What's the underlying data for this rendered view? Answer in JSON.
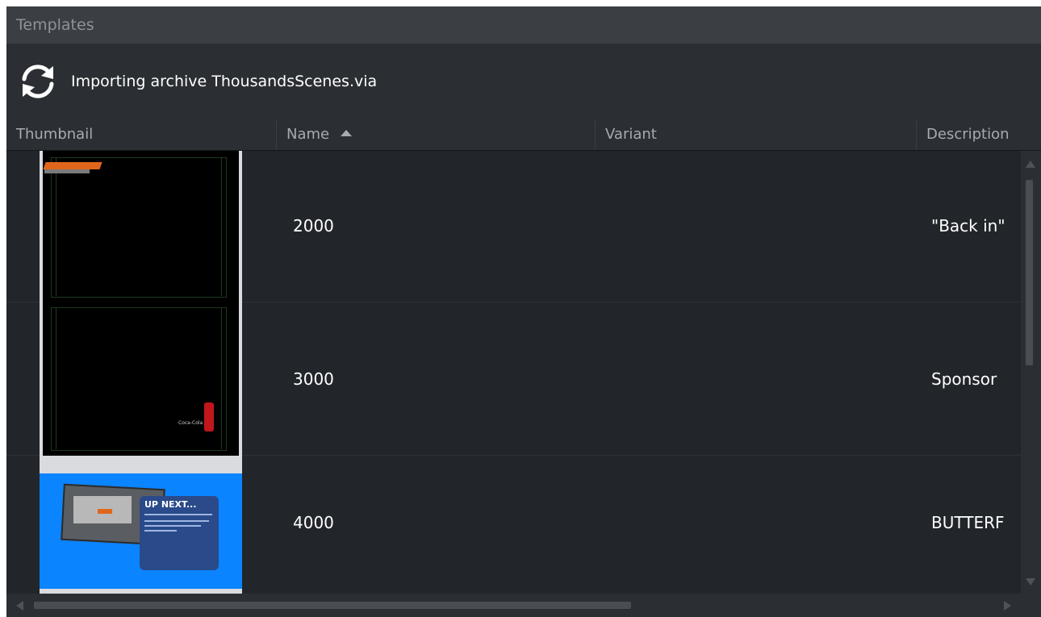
{
  "panel": {
    "title": "Templates"
  },
  "status": {
    "icon": "sync-icon",
    "message": "Importing archive ThousandsScenes.via"
  },
  "table": {
    "columns": [
      {
        "label": "Thumbnail"
      },
      {
        "label": "Name",
        "sorted": "ascending"
      },
      {
        "label": "Variant"
      },
      {
        "label": "Description"
      }
    ],
    "rows": [
      {
        "name": "2000",
        "variant": "",
        "description": "\"Back in\""
      },
      {
        "name": "3000",
        "variant": "",
        "description": "Sponsor"
      },
      {
        "name": "4000",
        "variant": "",
        "description": "BUTTERF"
      }
    ]
  },
  "thumbnails": {
    "t3_title": "UP NEXT...",
    "t2_caption": "Coca-Cola"
  },
  "colors": {
    "panel_bg": "#22262a",
    "titlebar_bg": "#3b3f43",
    "header_bg": "#2b2f33",
    "thumb_blue": "#0a84ff",
    "thumb_orange": "#e0661c"
  }
}
